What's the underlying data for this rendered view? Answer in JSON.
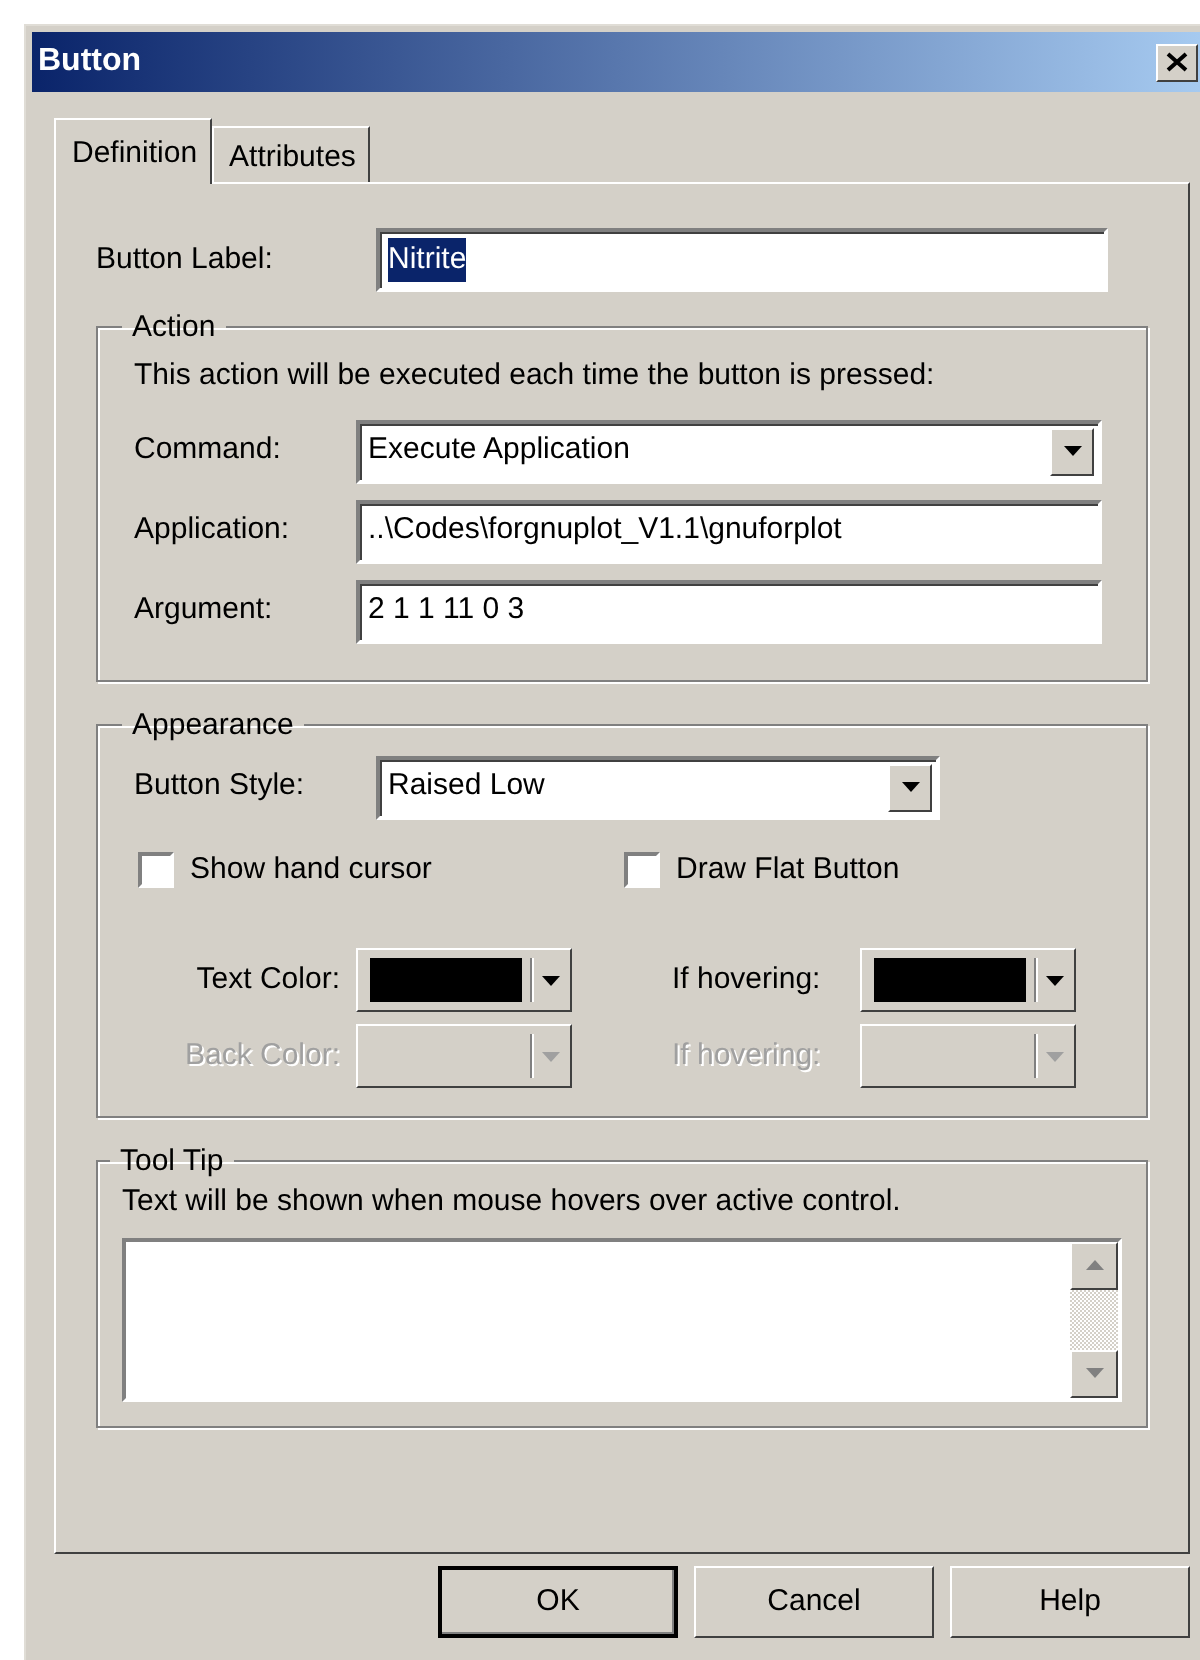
{
  "window": {
    "title": "Button"
  },
  "tabs": [
    {
      "label": "Definition",
      "selected": true
    },
    {
      "label": "Attributes",
      "selected": false
    }
  ],
  "button_label": {
    "label": "Button Label:",
    "value": "Nitrite",
    "text_selected": true
  },
  "action": {
    "title": "Action",
    "description": "This action will be executed each time the button is pressed:",
    "fields": [
      {
        "kind": "dropdown",
        "label": "Command:",
        "value": "Execute Application"
      },
      {
        "kind": "text",
        "label": "Application:",
        "value": "..\\Codes\\forgnuplot_V1.1\\gnuforplot"
      },
      {
        "kind": "text",
        "label": "Argument:",
        "value": "2  1  1  11  0  3"
      }
    ]
  },
  "appearance": {
    "title": "Appearance",
    "style": {
      "label": "Button Style:",
      "value": "Raised Low"
    },
    "checkboxes": [
      {
        "label": "Show hand cursor",
        "checked": false
      },
      {
        "label": "Draw Flat Button",
        "checked": false
      }
    ],
    "colors": [
      {
        "label": "Text Color:",
        "color": "#000000",
        "disabled": false
      },
      {
        "label": "If hovering:",
        "color": "#000000",
        "disabled": false
      },
      {
        "label": "Back Color:",
        "disabled": true
      },
      {
        "label": "If hovering:",
        "disabled": true
      }
    ]
  },
  "tooltip": {
    "title": "Tool Tip",
    "description": "Text will be shown when mouse hovers over active control."
  },
  "buttons": [
    {
      "label": "OK",
      "default": true
    },
    {
      "label": "Cancel",
      "default": false
    },
    {
      "label": "Help",
      "default": false
    }
  ]
}
